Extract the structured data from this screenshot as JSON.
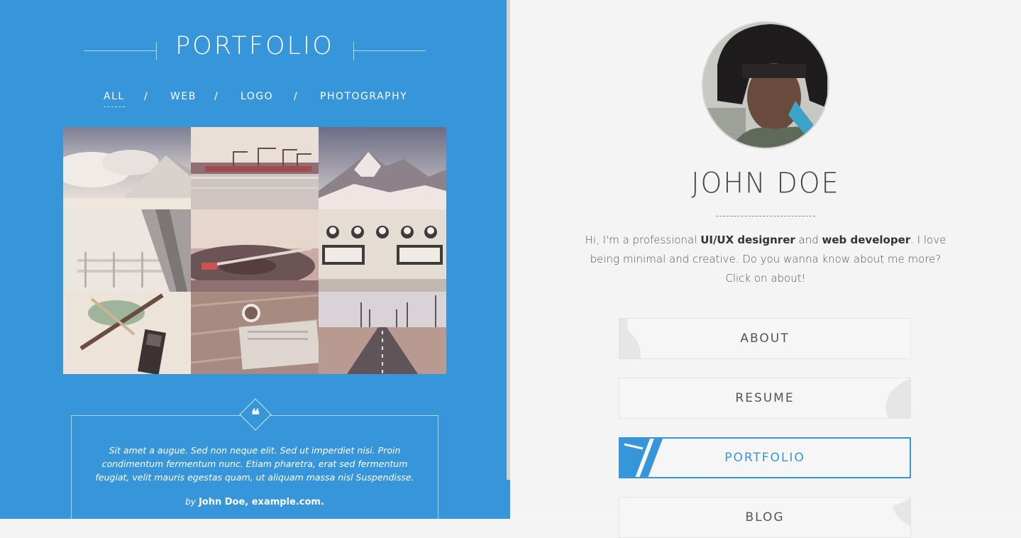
{
  "portfolio": {
    "title": "PORTFOLIO",
    "filters": [
      {
        "label": "ALL",
        "active": true
      },
      {
        "label": "WEB",
        "active": false
      },
      {
        "label": "LOGO",
        "active": false
      },
      {
        "label": "PHOTOGRAPHY",
        "active": false
      }
    ],
    "separator": "/",
    "thumbnails": [
      "clouds-roof-photo",
      "harbor-cranes-photo",
      "snowy-mountain-photo",
      "frozen-fence-photo",
      "turntable-photo",
      "tape-deck-buttons-photo",
      "compass-tools-photo",
      "desk-coffee-photo",
      "empty-road-photo"
    ]
  },
  "quote": {
    "icon": "quote-icon",
    "text": "Sit amet a augue. Sed non neque elit. Sed ut imperdiet nisi. Proin condimentum fermentum nunc. Etiam pharetra, erat sed fermentum feugiat, velit mauris egestas quam, ut aliquam massa nisl Suspendisse.",
    "by_prefix": "by",
    "author": "John Doe, example.com."
  },
  "profile": {
    "name": "JOHN DOE",
    "bio_1": "Hi, I'm a professional ",
    "bio_strong_1": "UI/UX designrer",
    "bio_2": " and ",
    "bio_strong_2": "web developer",
    "bio_3": ". I love being minimal and creative. Do you wanna know about me more? Click on about!"
  },
  "nav": [
    {
      "label": "ABOUT",
      "active": false
    },
    {
      "label": "RESUME",
      "active": false
    },
    {
      "label": "PORTFOLIO",
      "active": true
    },
    {
      "label": "BLOG",
      "active": false
    }
  ],
  "colors": {
    "accent": "#3796da",
    "panel_right": "#f4f4f4"
  }
}
